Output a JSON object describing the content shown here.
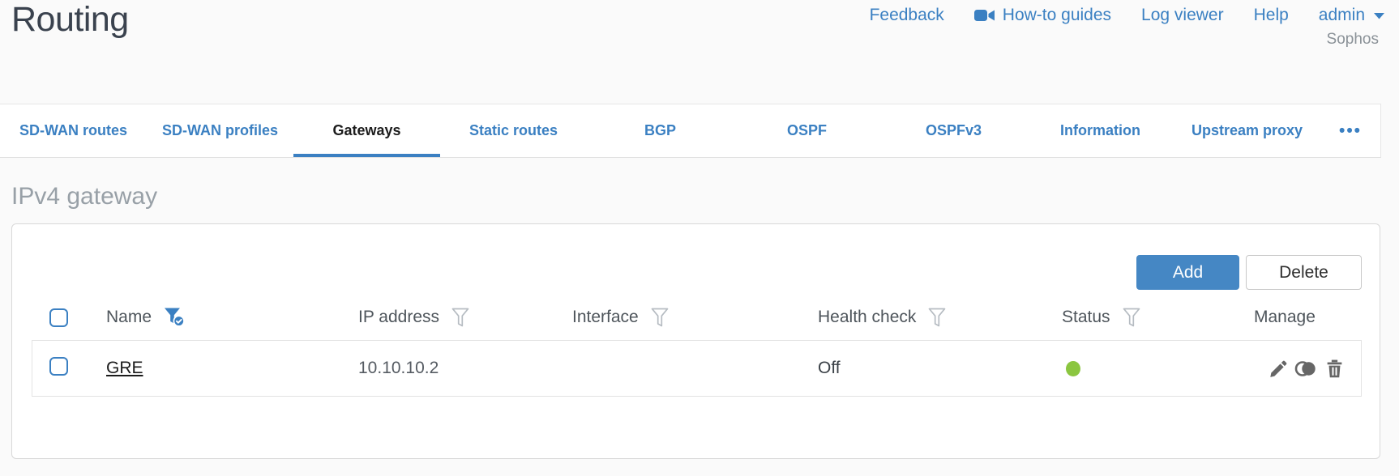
{
  "page": {
    "title": "Routing"
  },
  "header": {
    "links": [
      {
        "label": "Feedback"
      },
      {
        "label": "How-to guides",
        "icon": "video-camera-icon"
      },
      {
        "label": "Log viewer"
      },
      {
        "label": "Help"
      }
    ],
    "user_menu": {
      "label": "admin",
      "icon": "chevron-down-icon"
    },
    "brand": "Sophos"
  },
  "tabs": {
    "items": [
      {
        "label": "SD-WAN routes",
        "active": false
      },
      {
        "label": "SD-WAN profiles",
        "active": false
      },
      {
        "label": "Gateways",
        "active": true
      },
      {
        "label": "Static routes",
        "active": false
      },
      {
        "label": "BGP",
        "active": false
      },
      {
        "label": "OSPF",
        "active": false
      },
      {
        "label": "OSPFv3",
        "active": false
      },
      {
        "label": "Information",
        "active": false
      },
      {
        "label": "Upstream proxy",
        "active": false
      }
    ],
    "more_label": "•••"
  },
  "section": {
    "title": "IPv4 gateway"
  },
  "toolbar": {
    "add_label": "Add",
    "delete_label": "Delete"
  },
  "table": {
    "columns": [
      {
        "label": "Name",
        "filter": "active"
      },
      {
        "label": "IP address",
        "filter": "inactive"
      },
      {
        "label": "Interface",
        "filter": "inactive"
      },
      {
        "label": "Health check",
        "filter": "inactive"
      },
      {
        "label": "Status",
        "filter": "inactive"
      },
      {
        "label": "Manage",
        "filter": "none"
      }
    ],
    "rows": [
      {
        "name": "GRE",
        "ip_address": "10.10.10.2",
        "interface": "",
        "health_check": "Off",
        "status": "up",
        "actions": [
          "edit",
          "clone",
          "delete"
        ]
      }
    ]
  },
  "colors": {
    "accent_blue": "#3b80c2",
    "button_blue": "#4587c4",
    "status_green": "#8bc640"
  }
}
